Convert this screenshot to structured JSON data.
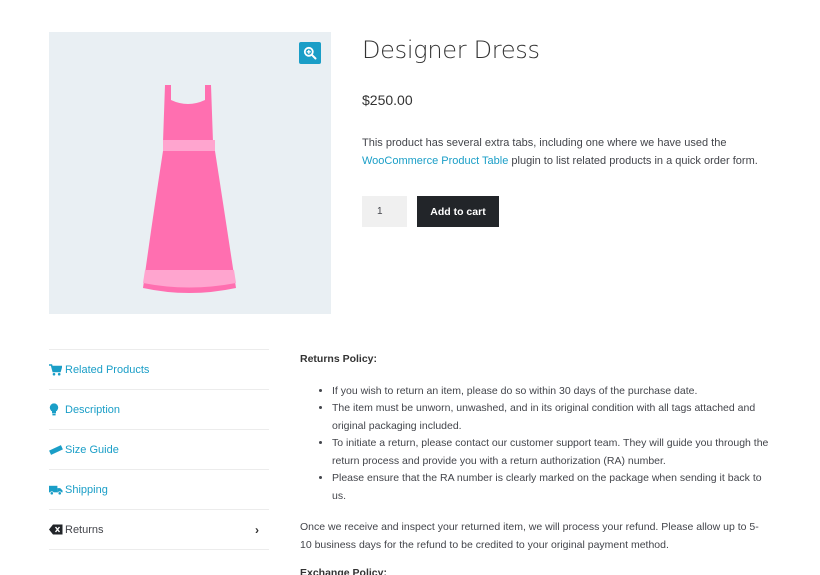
{
  "product": {
    "title": "Designer Dress",
    "price": "$250.00",
    "description_before_link": "This product has several extra tabs, including one where we have used the ",
    "description_link": "WooCommerce Product Table",
    "description_after_link": " plugin to list related products in a quick order form.",
    "quantity": "1",
    "add_to_cart_label": "Add to cart"
  },
  "gallery": {
    "zoom_icon": "magnifier-plus-icon",
    "image": "pink-dress",
    "colors": {
      "background": "#e9eff3",
      "dress": "#ff6fb0",
      "dress_light": "#ffa5cf",
      "zoom": "#1a9ec7"
    }
  },
  "tabs": [
    {
      "label": "Related Products",
      "icon": "cart-icon"
    },
    {
      "label": "Description",
      "icon": "lightbulb-icon"
    },
    {
      "label": "Size Guide",
      "icon": "ruler-icon"
    },
    {
      "label": "Shipping",
      "icon": "truck-icon"
    },
    {
      "label": "Returns",
      "icon": "backspace-icon",
      "active": true
    }
  ],
  "returns": {
    "heading": "Returns Policy:",
    "items": [
      "If you wish to return an item, please do so within 30 days of the purchase date.",
      "The item must be unworn, unwashed, and in its original condition with all tags attached and original packaging included.",
      "To initiate a return, please contact our customer support team. They will guide you through the return process and provide you with a return authorization (RA) number.",
      "Please ensure that the RA number is clearly marked on the package when sending it back to us."
    ],
    "paragraph": "Once we receive and inspect your returned item, we will process your refund. Please allow up to 5-10 business days for the refund to be credited to your original payment method.",
    "exchange_heading": "Exchange Policy:"
  },
  "colors": {
    "accent": "#1a9ec7",
    "button": "#222529",
    "text": "#43454b"
  }
}
